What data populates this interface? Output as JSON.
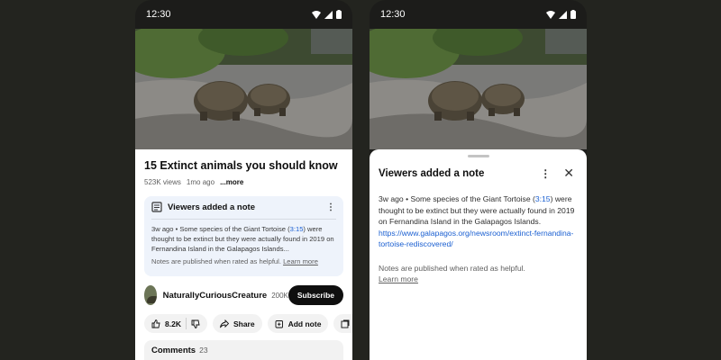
{
  "status": {
    "time": "12:30"
  },
  "video": {
    "title": "15 Extinct animals you should know",
    "views": "523K views",
    "age": "1mo ago",
    "more": "...more"
  },
  "note_card": {
    "heading": "Viewers added a note",
    "text_before": "3w ago • Some species of the Giant Tortoise (",
    "timestamp": "3:15",
    "text_after": ") were thought to be extinct but they were actually found in 2019 on Fernandina Island in the Galapagos Islands...",
    "footer": "Notes are published when rated as helpful.",
    "learn_more": "Learn more"
  },
  "channel": {
    "name": "NaturallyCuriousCreature",
    "subscribers": "200K",
    "subscribe_label": "Subscribe"
  },
  "actions": {
    "likes": "8.2K",
    "share": "Share",
    "add_note": "Add note",
    "save": "Sa"
  },
  "comments": {
    "label": "Comments",
    "count": "23"
  },
  "sheet": {
    "title": "Viewers added a note",
    "text_before": "3w ago • Some species of the Giant Tortoise (",
    "timestamp": "3:15",
    "text_after": ") were thought to be extinct but they were actually found in 2019 on Fernandina Island in the Galapagos Islands. ",
    "link": "https://www.galapagos.org/newsroom/extinct-fernandina-tortoise-rediscovered/",
    "footer": "Notes are published when rated as helpful.",
    "learn_more": "Learn more"
  },
  "icons": {
    "wifi": "wifi-icon",
    "signal": "signal-icon",
    "battery": "battery-icon",
    "note": "note-icon",
    "more": "more-vert-icon",
    "close": "close-icon",
    "like": "thumbs-up-icon",
    "dislike": "thumbs-down-icon",
    "share": "share-icon",
    "add_note": "add-note-icon",
    "save": "save-icon"
  },
  "colors": {
    "background": "#23241f",
    "note_card_bg": "#eef3fb",
    "link": "#1a5fd1",
    "subscribe_bg": "#0f0f0f"
  }
}
